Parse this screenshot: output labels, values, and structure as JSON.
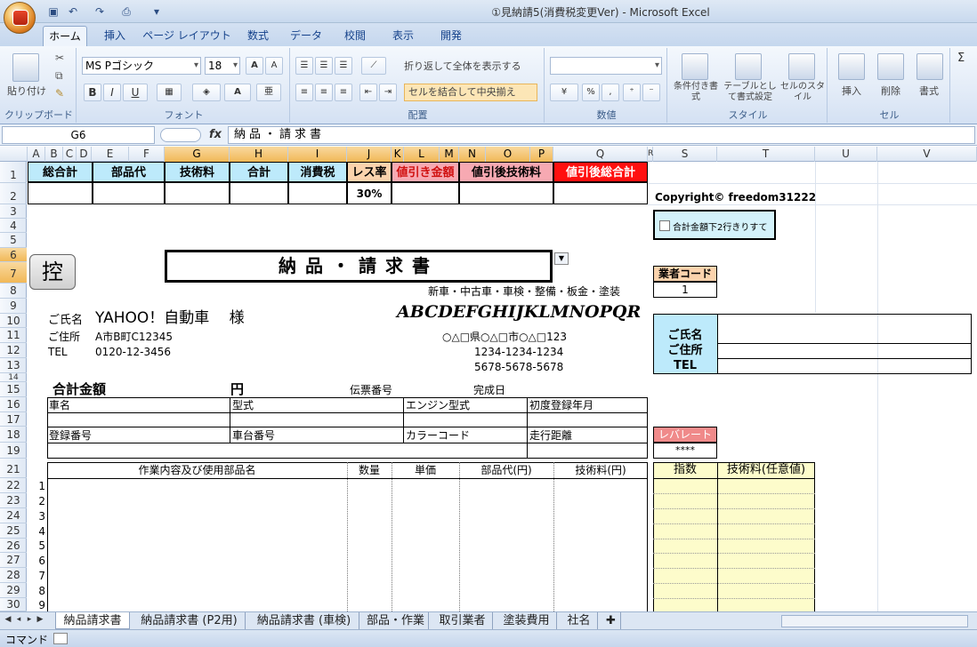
{
  "window": {
    "title": "①見納請5(消費税変更Ver) - Microsoft Excel"
  },
  "ribbon": {
    "tabs": [
      "ホーム",
      "挿入",
      "ページ レイアウト",
      "数式",
      "データ",
      "校閲",
      "表示",
      "開発"
    ],
    "clipboard": {
      "paste": "貼り付け",
      "label": "クリップボード"
    },
    "font": {
      "name": "MS Pゴシック",
      "size": "18",
      "label": "フォント",
      "bold": "B",
      "italic": "I",
      "underline": "U"
    },
    "alignment": {
      "wrap": "折り返して全体を表示する",
      "merge": "セルを結合して中央揃え",
      "label": "配置"
    },
    "number": {
      "label": "数値",
      "percent": "%"
    },
    "styles": {
      "conditional": "条件付き書式",
      "table": "テーブルとして書式設定",
      "cellstyle": "セルのスタイル",
      "label": "スタイル"
    },
    "cells": {
      "insert": "挿入",
      "delete": "削除",
      "format": "書式",
      "label": "セル"
    }
  },
  "formula_bar": {
    "name_box": "G6",
    "fx": "fx",
    "content": "納品・請求書"
  },
  "columns": [
    "A",
    "B",
    "C",
    "D",
    "E",
    "F",
    "G",
    "H",
    "I",
    "J",
    "K",
    "L",
    "M",
    "N",
    "O",
    "P",
    "Q",
    "R",
    "S",
    "T",
    "U",
    "V"
  ],
  "rows": [
    "1",
    "2",
    "3",
    "4",
    "5",
    "6",
    "7",
    "8",
    "9",
    "10",
    "11",
    "12",
    "13",
    "14",
    "15",
    "16",
    "17",
    "18",
    "19",
    "21",
    "22",
    "23",
    "24",
    "25",
    "26",
    "27",
    "28",
    "29",
    "30"
  ],
  "sheet": {
    "summary_headers": [
      "総合計",
      "部品代",
      "技術料",
      "合計",
      "消費税",
      "レス率",
      "値引き金額",
      "値引後技術料",
      "値引後総合計"
    ],
    "rate_value": "30%",
    "copyright": "Copyright© freedom31222",
    "checkbox_label": "合計金額下2行きりすて",
    "ctrl_button": "控",
    "doc_title": "納品・請求書",
    "vendor_code_label": "業者コード",
    "vendor_code_value": "1",
    "services": "新車・中古車・車検・整備・板金・塗装",
    "company_logo": "ABCDEFGHIJKLMNOPQR",
    "company_address": "○△□県○△□市○△□123",
    "company_tel": "1234-1234-1234",
    "company_fax": "5678-5678-5678",
    "customer_name_label": "ご氏名",
    "customer_name": "YAHOO！自動車　 様",
    "customer_address_label": "ご住所",
    "customer_address": "A市B町C12345",
    "customer_tel_label": "TEL",
    "customer_tel": "0120-12-3456",
    "side_name": "ご氏名",
    "side_address": "ご住所",
    "side_tel": "TEL",
    "total_label": "合計金額",
    "yen": "円",
    "slip_no": "伝票番号",
    "complete_date": "完成日",
    "car_name": "車名",
    "model": "型式",
    "engine_model": "エンジン型式",
    "first_reg": "初度登録年月",
    "reg_no": "登録番号",
    "chassis_no": "車台番号",
    "color_code": "カラーコード",
    "mileage": "走行距離",
    "lever_rate": "レバレート",
    "lever_value": "****",
    "work_headers": [
      "作業内容及び使用部品名",
      "数量",
      "単価",
      "部品代(円)",
      "技術料(円)"
    ],
    "side_headers": [
      "指数",
      "技術料(任意値)"
    ],
    "item_numbers": [
      "1",
      "2",
      "3",
      "4",
      "5",
      "6",
      "7",
      "8",
      "9"
    ]
  },
  "sheet_tabs": [
    "納品請求書",
    "納品請求書 (P2用)",
    "納品請求書 (車検)",
    "部品・作業",
    "取引業者",
    "塗装費用",
    "社名"
  ],
  "status": {
    "mode": "コマンド"
  },
  "colors": {
    "header_blue": "#bdeafb",
    "header_orange": "#fbd3ad",
    "header_pink": "#f7a9b2",
    "header_red": "#ff1010",
    "side_yellow": "#fdfccb",
    "lever_pink": "#f08a8a"
  }
}
